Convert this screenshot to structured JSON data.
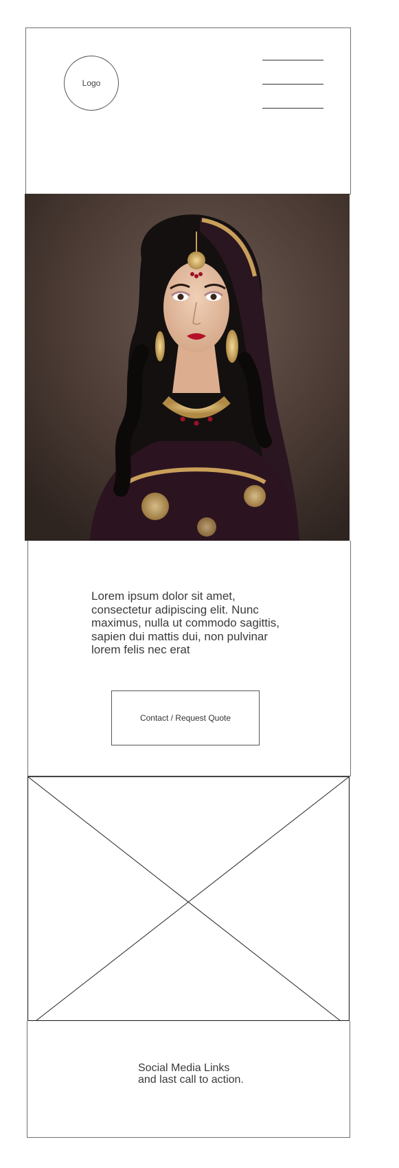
{
  "header": {
    "logo_label": "Logo",
    "menu_icon": "hamburger-menu-icon"
  },
  "hero": {
    "image_subject": "woman-in-bridal-jewelry-photo"
  },
  "intro": {
    "text": "Lorem ipsum dolor sit amet, consectetur adipiscing elit. Nunc maximus, nulla ut commodo sagittis, sapien dui mattis dui, non pulvinar lorem felis nec erat"
  },
  "cta": {
    "label": "Contact / Request Quote"
  },
  "footer": {
    "line1": "Social Media Links",
    "line2": "and last call to action."
  },
  "colors": {
    "wireframe_line": "#6f6f6f",
    "text": "#3a3a3a",
    "photo_background": "#4a3a33"
  }
}
